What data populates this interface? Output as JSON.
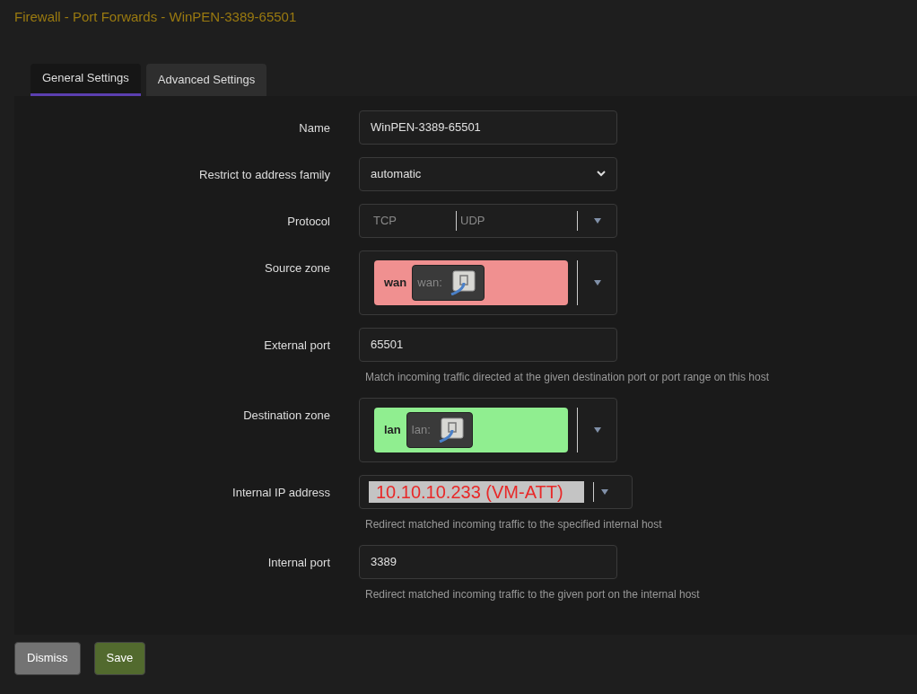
{
  "title": "Firewall - Port Forwards - WinPEN-3389-65501",
  "tabs": [
    {
      "label": "General Settings",
      "selected": true
    },
    {
      "label": "Advanced Settings",
      "selected": false
    }
  ],
  "fields": [
    {
      "kind": "text",
      "label": "Name",
      "value": "WinPEN-3389-65501"
    },
    {
      "kind": "select",
      "label": "Restrict to address family",
      "value": "automatic"
    },
    {
      "kind": "multi",
      "label": "Protocol",
      "options": [
        "TCP",
        "UDP"
      ]
    },
    {
      "kind": "zone",
      "label": "Source zone",
      "zone": "wan",
      "network": "wan:",
      "color": "#f09090"
    },
    {
      "kind": "text",
      "label": "External port",
      "value": "65501",
      "hint": "Match incoming traffic directed at the given destination port or port range on this host"
    },
    {
      "kind": "zone",
      "label": "Destination zone",
      "zone": "lan",
      "network": "lan:",
      "color": "#90ee90"
    },
    {
      "kind": "combo",
      "label": "Internal IP address",
      "value": "10.10.10.233 (VM-ATT)",
      "hint": "Redirect matched incoming traffic to the specified internal host"
    },
    {
      "kind": "text",
      "label": "Internal port",
      "value": "3389",
      "hint": "Redirect matched incoming traffic to the given port on the internal host"
    }
  ],
  "buttons": [
    {
      "label": "Dismiss",
      "kind": "neutral"
    },
    {
      "label": "Save",
      "kind": "primary"
    }
  ]
}
